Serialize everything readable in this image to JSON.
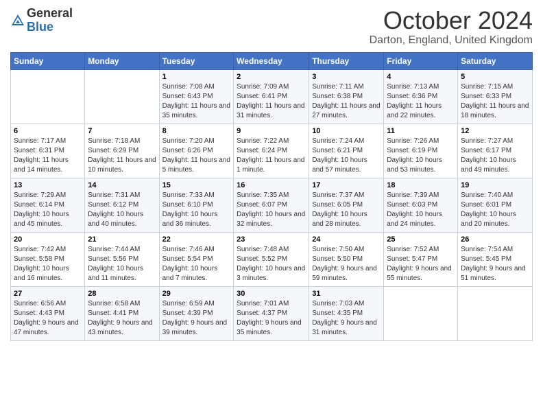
{
  "header": {
    "logo_general": "General",
    "logo_blue": "Blue",
    "month_title": "October 2024",
    "location": "Darton, England, United Kingdom"
  },
  "weekdays": [
    "Sunday",
    "Monday",
    "Tuesday",
    "Wednesday",
    "Thursday",
    "Friday",
    "Saturday"
  ],
  "weeks": [
    [
      {
        "day": "",
        "sunrise": "",
        "sunset": "",
        "daylight": ""
      },
      {
        "day": "",
        "sunrise": "",
        "sunset": "",
        "daylight": ""
      },
      {
        "day": "1",
        "sunrise": "Sunrise: 7:08 AM",
        "sunset": "Sunset: 6:43 PM",
        "daylight": "Daylight: 11 hours and 35 minutes."
      },
      {
        "day": "2",
        "sunrise": "Sunrise: 7:09 AM",
        "sunset": "Sunset: 6:41 PM",
        "daylight": "Daylight: 11 hours and 31 minutes."
      },
      {
        "day": "3",
        "sunrise": "Sunrise: 7:11 AM",
        "sunset": "Sunset: 6:38 PM",
        "daylight": "Daylight: 11 hours and 27 minutes."
      },
      {
        "day": "4",
        "sunrise": "Sunrise: 7:13 AM",
        "sunset": "Sunset: 6:36 PM",
        "daylight": "Daylight: 11 hours and 22 minutes."
      },
      {
        "day": "5",
        "sunrise": "Sunrise: 7:15 AM",
        "sunset": "Sunset: 6:33 PM",
        "daylight": "Daylight: 11 hours and 18 minutes."
      }
    ],
    [
      {
        "day": "6",
        "sunrise": "Sunrise: 7:17 AM",
        "sunset": "Sunset: 6:31 PM",
        "daylight": "Daylight: 11 hours and 14 minutes."
      },
      {
        "day": "7",
        "sunrise": "Sunrise: 7:18 AM",
        "sunset": "Sunset: 6:29 PM",
        "daylight": "Daylight: 11 hours and 10 minutes."
      },
      {
        "day": "8",
        "sunrise": "Sunrise: 7:20 AM",
        "sunset": "Sunset: 6:26 PM",
        "daylight": "Daylight: 11 hours and 5 minutes."
      },
      {
        "day": "9",
        "sunrise": "Sunrise: 7:22 AM",
        "sunset": "Sunset: 6:24 PM",
        "daylight": "Daylight: 11 hours and 1 minute."
      },
      {
        "day": "10",
        "sunrise": "Sunrise: 7:24 AM",
        "sunset": "Sunset: 6:21 PM",
        "daylight": "Daylight: 10 hours and 57 minutes."
      },
      {
        "day": "11",
        "sunrise": "Sunrise: 7:26 AM",
        "sunset": "Sunset: 6:19 PM",
        "daylight": "Daylight: 10 hours and 53 minutes."
      },
      {
        "day": "12",
        "sunrise": "Sunrise: 7:27 AM",
        "sunset": "Sunset: 6:17 PM",
        "daylight": "Daylight: 10 hours and 49 minutes."
      }
    ],
    [
      {
        "day": "13",
        "sunrise": "Sunrise: 7:29 AM",
        "sunset": "Sunset: 6:14 PM",
        "daylight": "Daylight: 10 hours and 45 minutes."
      },
      {
        "day": "14",
        "sunrise": "Sunrise: 7:31 AM",
        "sunset": "Sunset: 6:12 PM",
        "daylight": "Daylight: 10 hours and 40 minutes."
      },
      {
        "day": "15",
        "sunrise": "Sunrise: 7:33 AM",
        "sunset": "Sunset: 6:10 PM",
        "daylight": "Daylight: 10 hours and 36 minutes."
      },
      {
        "day": "16",
        "sunrise": "Sunrise: 7:35 AM",
        "sunset": "Sunset: 6:07 PM",
        "daylight": "Daylight: 10 hours and 32 minutes."
      },
      {
        "day": "17",
        "sunrise": "Sunrise: 7:37 AM",
        "sunset": "Sunset: 6:05 PM",
        "daylight": "Daylight: 10 hours and 28 minutes."
      },
      {
        "day": "18",
        "sunrise": "Sunrise: 7:39 AM",
        "sunset": "Sunset: 6:03 PM",
        "daylight": "Daylight: 10 hours and 24 minutes."
      },
      {
        "day": "19",
        "sunrise": "Sunrise: 7:40 AM",
        "sunset": "Sunset: 6:01 PM",
        "daylight": "Daylight: 10 hours and 20 minutes."
      }
    ],
    [
      {
        "day": "20",
        "sunrise": "Sunrise: 7:42 AM",
        "sunset": "Sunset: 5:58 PM",
        "daylight": "Daylight: 10 hours and 16 minutes."
      },
      {
        "day": "21",
        "sunrise": "Sunrise: 7:44 AM",
        "sunset": "Sunset: 5:56 PM",
        "daylight": "Daylight: 10 hours and 11 minutes."
      },
      {
        "day": "22",
        "sunrise": "Sunrise: 7:46 AM",
        "sunset": "Sunset: 5:54 PM",
        "daylight": "Daylight: 10 hours and 7 minutes."
      },
      {
        "day": "23",
        "sunrise": "Sunrise: 7:48 AM",
        "sunset": "Sunset: 5:52 PM",
        "daylight": "Daylight: 10 hours and 3 minutes."
      },
      {
        "day": "24",
        "sunrise": "Sunrise: 7:50 AM",
        "sunset": "Sunset: 5:50 PM",
        "daylight": "Daylight: 9 hours and 59 minutes."
      },
      {
        "day": "25",
        "sunrise": "Sunrise: 7:52 AM",
        "sunset": "Sunset: 5:47 PM",
        "daylight": "Daylight: 9 hours and 55 minutes."
      },
      {
        "day": "26",
        "sunrise": "Sunrise: 7:54 AM",
        "sunset": "Sunset: 5:45 PM",
        "daylight": "Daylight: 9 hours and 51 minutes."
      }
    ],
    [
      {
        "day": "27",
        "sunrise": "Sunrise: 6:56 AM",
        "sunset": "Sunset: 4:43 PM",
        "daylight": "Daylight: 9 hours and 47 minutes."
      },
      {
        "day": "28",
        "sunrise": "Sunrise: 6:58 AM",
        "sunset": "Sunset: 4:41 PM",
        "daylight": "Daylight: 9 hours and 43 minutes."
      },
      {
        "day": "29",
        "sunrise": "Sunrise: 6:59 AM",
        "sunset": "Sunset: 4:39 PM",
        "daylight": "Daylight: 9 hours and 39 minutes."
      },
      {
        "day": "30",
        "sunrise": "Sunrise: 7:01 AM",
        "sunset": "Sunset: 4:37 PM",
        "daylight": "Daylight: 9 hours and 35 minutes."
      },
      {
        "day": "31",
        "sunrise": "Sunrise: 7:03 AM",
        "sunset": "Sunset: 4:35 PM",
        "daylight": "Daylight: 9 hours and 31 minutes."
      },
      {
        "day": "",
        "sunrise": "",
        "sunset": "",
        "daylight": ""
      },
      {
        "day": "",
        "sunrise": "",
        "sunset": "",
        "daylight": ""
      }
    ]
  ]
}
